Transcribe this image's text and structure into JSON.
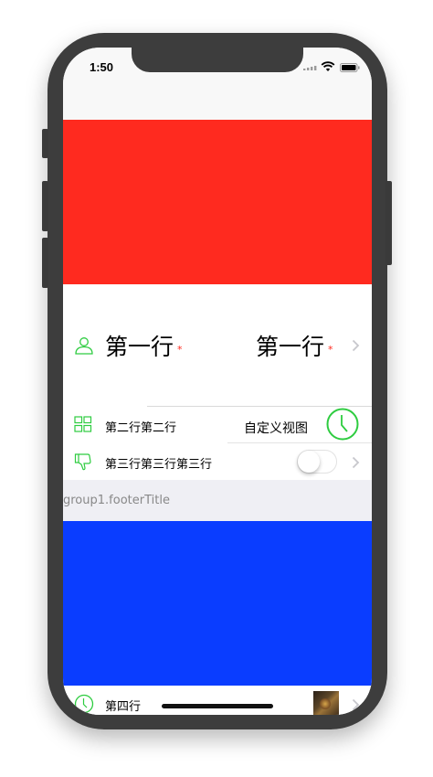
{
  "status": {
    "time": "1:50"
  },
  "colors": {
    "red_block": "#ff2a1f",
    "blue_block": "#0a3dff",
    "accent": "#2ecc40",
    "required": "#ff2a1f"
  },
  "row1": {
    "icon": "user-icon",
    "title": "第一行",
    "required_mark": "*",
    "value": "第一行",
    "value_mark": "*"
  },
  "row2": {
    "icon": "grid-icon",
    "title": "第二行第二行",
    "custom_view": "自定义视图",
    "custom_icon": "clock-icon"
  },
  "row3": {
    "icon": "thumbs-down-icon",
    "title": "第三行第三行第三行",
    "toggle_on": false
  },
  "group1": {
    "footer_title": "group1.footerTitle"
  },
  "row4": {
    "icon": "clock-icon",
    "title": "第四行",
    "thumbnail": "thumbnail-image"
  }
}
